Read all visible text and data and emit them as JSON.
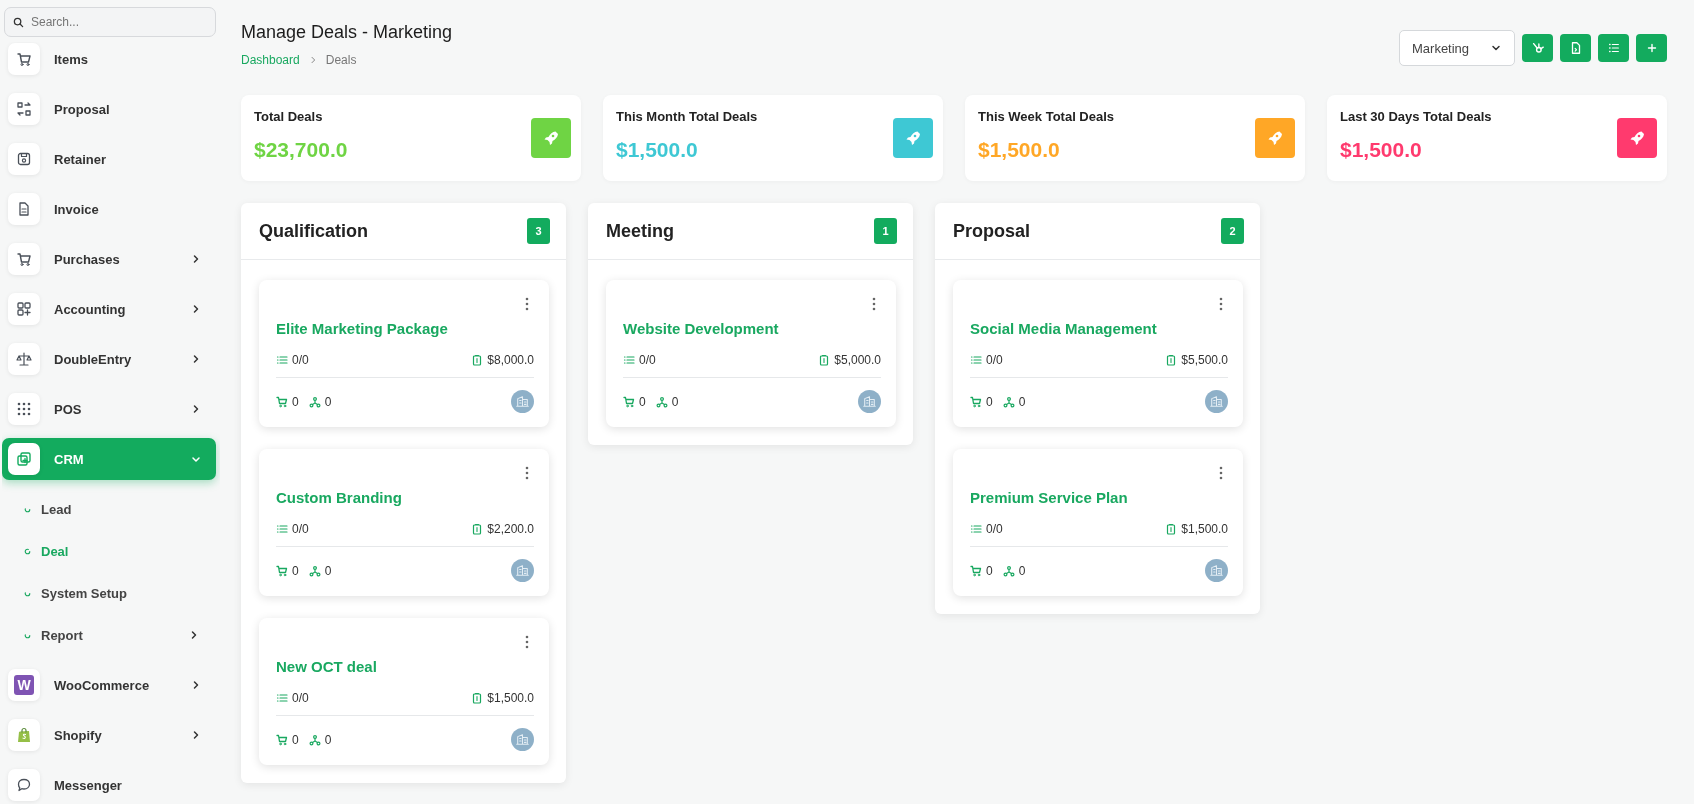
{
  "sidebar": {
    "search": {
      "placeholder": "Search..."
    },
    "items": [
      {
        "label": "Items",
        "expandable": false,
        "selected": false
      },
      {
        "label": "Proposal",
        "expandable": false,
        "selected": false
      },
      {
        "label": "Retainer",
        "expandable": false,
        "selected": false
      },
      {
        "label": "Invoice",
        "expandable": false,
        "selected": false
      },
      {
        "label": "Purchases",
        "expandable": true,
        "expanded": false,
        "selected": false
      },
      {
        "label": "Accounting",
        "expandable": true,
        "expanded": false,
        "selected": false
      },
      {
        "label": "DoubleEntry",
        "expandable": true,
        "expanded": false,
        "selected": false
      },
      {
        "label": "POS",
        "expandable": true,
        "expanded": false,
        "selected": false
      },
      {
        "label": "CRM",
        "expandable": true,
        "expanded": true,
        "selected": true,
        "children": [
          {
            "label": "Lead",
            "expandable": false,
            "selected": false
          },
          {
            "label": "Deal",
            "expandable": false,
            "selected": true
          },
          {
            "label": "System Setup",
            "expandable": false,
            "selected": false
          },
          {
            "label": "Report",
            "expandable": true,
            "selected": false
          }
        ]
      },
      {
        "label": "WooCommerce",
        "logo": "W",
        "expandable": true,
        "expanded": false,
        "selected": false
      },
      {
        "label": "Shopify",
        "expandable": true,
        "expanded": false,
        "selected": false
      },
      {
        "label": "Messenger",
        "expandable": false,
        "selected": false
      }
    ]
  },
  "header": {
    "title": "Manage Deals - Marketing",
    "breadcrumb": [
      "Dashboard",
      "Deals"
    ],
    "pipeline": "Marketing"
  },
  "stats": [
    {
      "label": "Total Deals",
      "value": "$23,700.0",
      "color": "#6fd444"
    },
    {
      "label": "This Month Total Deals",
      "value": "$1,500.0",
      "color": "#3ec8d4"
    },
    {
      "label": "This Week Total Deals",
      "value": "$1,500.0",
      "color": "#ffa726"
    },
    {
      "label": "Last 30 Days Total Deals",
      "value": "$1,500.0",
      "color": "#ff3a6e"
    }
  ],
  "columns": [
    {
      "name": "Qualification",
      "count": "3",
      "deals": [
        {
          "title": "Elite Marketing Package",
          "tasks": "0/0",
          "amount": "$8,000.0",
          "products": "0",
          "sources": "0"
        },
        {
          "title": "Custom Branding",
          "tasks": "0/0",
          "amount": "$2,200.0",
          "products": "0",
          "sources": "0"
        },
        {
          "title": "New OCT deal",
          "tasks": "0/0",
          "amount": "$1,500.0",
          "products": "0",
          "sources": "0"
        }
      ]
    },
    {
      "name": "Meeting",
      "count": "1",
      "deals": [
        {
          "title": "Website Development",
          "tasks": "0/0",
          "amount": "$5,000.0",
          "products": "0",
          "sources": "0"
        }
      ]
    },
    {
      "name": "Proposal",
      "count": "2",
      "deals": [
        {
          "title": "Social Media Management",
          "tasks": "0/0",
          "amount": "$5,500.0",
          "products": "0",
          "sources": "0"
        },
        {
          "title": "Premium Service Plan",
          "tasks": "0/0",
          "amount": "$1,500.0",
          "products": "0",
          "sources": "0"
        }
      ]
    }
  ]
}
